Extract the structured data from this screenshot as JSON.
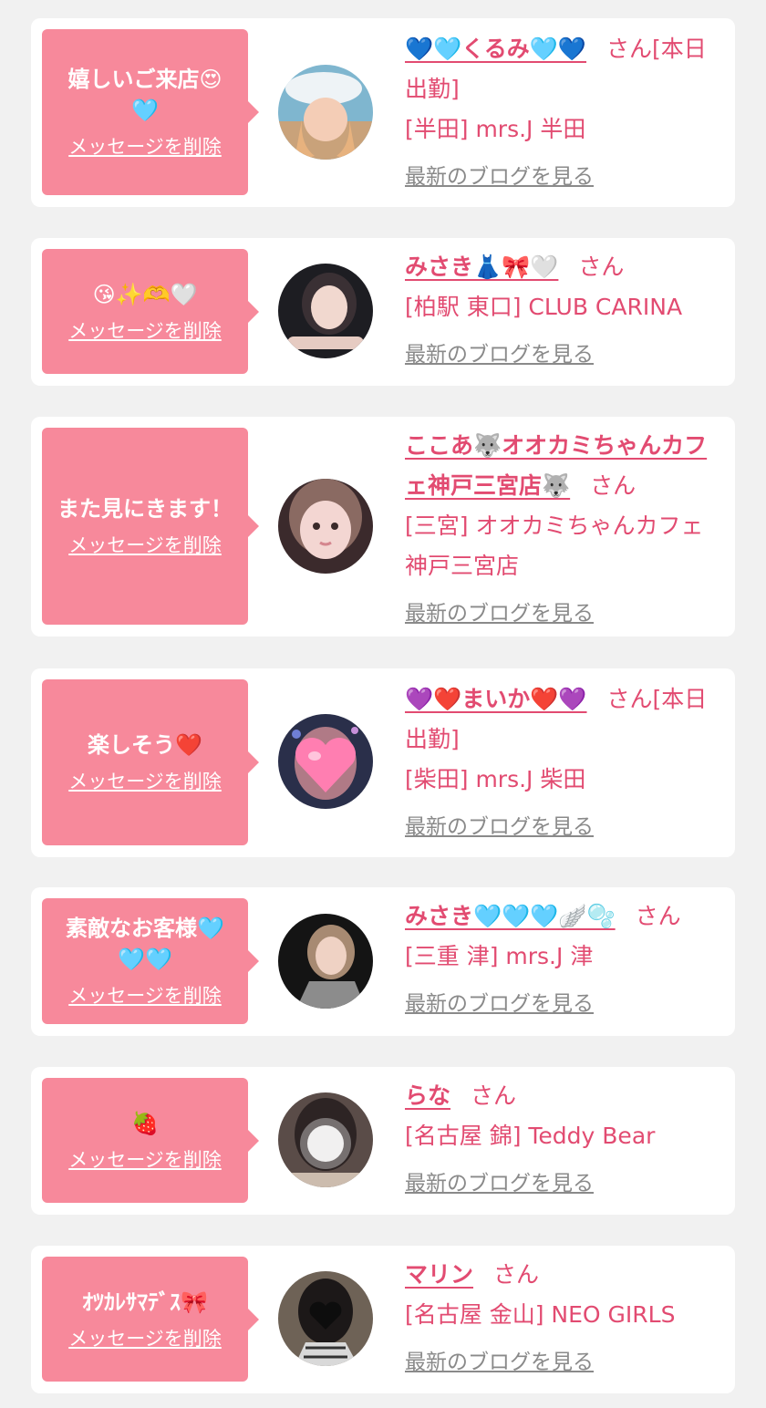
{
  "delete_label": "メッセージを削除",
  "san_label": "さん",
  "blog_label": "最新のブログを見る",
  "colors": {
    "background": "#f1f1f1",
    "card": "#ffffff",
    "bubble": "#f7899b",
    "accent_text": "#e24b71",
    "link_gray": "#8a8a8a"
  },
  "entries": [
    {
      "message": "嬉しいご来店😍🩵",
      "name": "💙🩵くるみ🩵💙",
      "san_suffix": "さん[本日出勤]",
      "shop": "[半田] mrs.J 半田",
      "avatar_icon": "profile-photo"
    },
    {
      "message": "😘✨🫶🤍",
      "name": "みさき👗🎀🤍",
      "san_suffix": "さん",
      "shop": "[柏駅 東口] CLUB CARINA",
      "avatar_icon": "profile-photo"
    },
    {
      "message": "また見にきます！",
      "name": "ここあ🐺オオカミちゃんカフェ神戸三宮店🐺",
      "san_suffix": "さん",
      "shop": "[三宮] オオカミちゃんカフェ神戸三宮店",
      "avatar_icon": "profile-photo"
    },
    {
      "message": "楽しそう❤️",
      "name": "💜❤️まいか❤️💜",
      "san_suffix": "さん[本日出勤]",
      "shop": "[柴田] mrs.J 柴田",
      "avatar_icon": "profile-photo-heart-sticker"
    },
    {
      "message": "素敵なお客様🩵🩵🩵",
      "name": "みさき🩵🩵🩵🪽🫧",
      "san_suffix": "さん",
      "shop": "[三重 津] mrs.J 津",
      "avatar_icon": "profile-photo"
    },
    {
      "message": "🍓",
      "name": "らな",
      "san_suffix": "さん",
      "shop": "[名古屋 錦] Teddy Bear",
      "avatar_icon": "profile-photo-blurred-face"
    },
    {
      "message": "ｵﾂｶﾚｻﾏﾃﾞｽ🎀",
      "name": "マリン",
      "san_suffix": "さん",
      "shop": "[名古屋 金山] NEO GIRLS",
      "avatar_icon": "profile-photo-heart-sticker"
    }
  ]
}
